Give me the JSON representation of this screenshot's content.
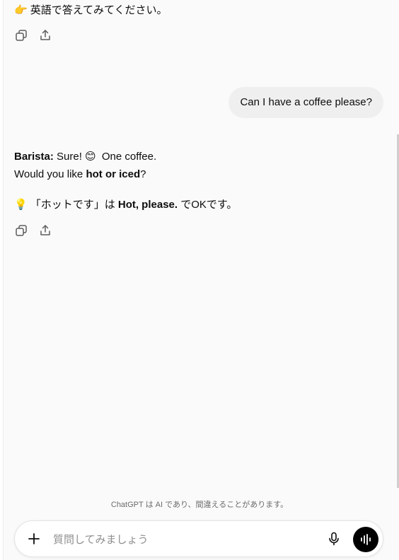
{
  "conversation": {
    "prev_assistant": {
      "emoji": "👉",
      "text": "英語で答えてみてください。"
    },
    "user_message": "Can I have a coffee please?",
    "assistant": {
      "speaker": "Barista:",
      "line1_text": " Sure! ",
      "line1_emoji": "😊",
      "line1_after": " One coffee.",
      "line2_before": "Would you like ",
      "line2_bold": "hot or iced",
      "line2_after": "?",
      "tip_emoji": "💡",
      "tip_before": "「ホットです」は ",
      "tip_bold": "Hot, please.",
      "tip_after": " でOKです。"
    }
  },
  "icons": {
    "copy": "copy-icon",
    "share": "share-icon",
    "plus": "plus-icon",
    "mic": "microphone-icon",
    "voice": "voice-mode-icon"
  },
  "footer": {
    "disclaimer": "ChatGPT は AI であり、間違えることがあります。"
  },
  "composer": {
    "placeholder": "質問してみましょう"
  },
  "colors": {
    "background": "#fafafa",
    "user_bubble": "#efefef",
    "voice_button": "#000000"
  }
}
